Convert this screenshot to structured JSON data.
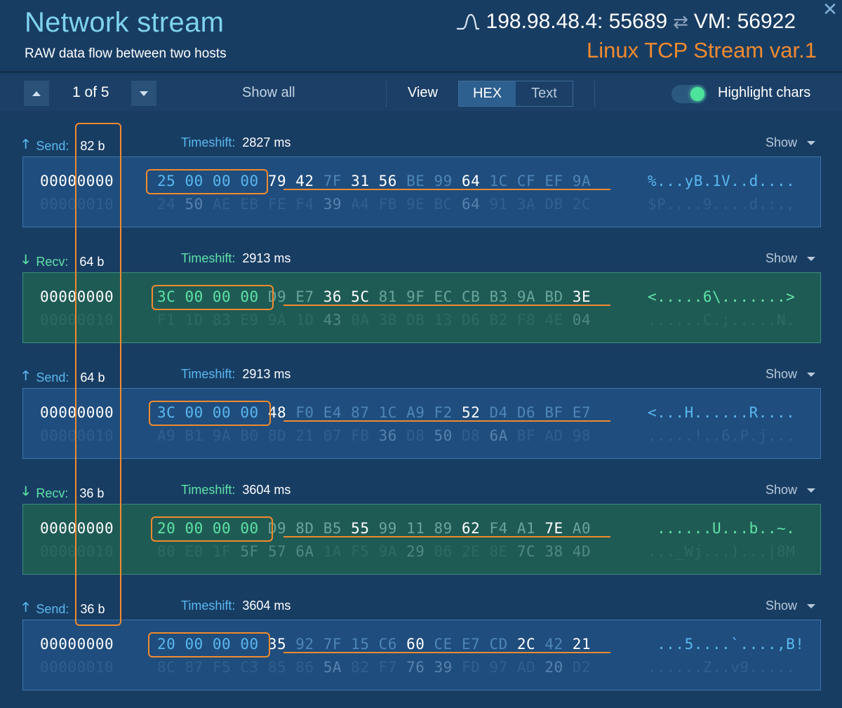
{
  "header": {
    "title": "Network stream",
    "subtitle": "RAW data flow between two hosts",
    "source": "198.98.48.4: 55689",
    "destination": "VM: 56922",
    "stream_name": "Linux TCP Stream var.1"
  },
  "toolbar": {
    "pager": "1 of 5",
    "show_all": "Show all",
    "view_label": "View",
    "view_hex": "HEX",
    "view_text": "Text",
    "highlight_label": "Highlight chars",
    "highlight_on": true
  },
  "labels": {
    "timeshift": "Timeshift:",
    "show": "Show"
  },
  "colors": {
    "accent_orange": "#f08a2e",
    "title_cyan": "#7fd3ee",
    "send_label": "#5ab8f0",
    "recv_label": "#5ee3a6"
  },
  "packets": [
    {
      "direction": "Send:",
      "size": "82 b",
      "timeshift": "2827 ms",
      "offset1": "00000000",
      "offset2": "00000010",
      "hex1": [
        "25",
        "00",
        "00",
        "00",
        "79",
        "42",
        "7F",
        "31",
        "56",
        "BE",
        "99",
        "64",
        "1C",
        "CF",
        "EF",
        "9A"
      ],
      "hex2": [
        "24",
        "50",
        "AE",
        "EB",
        "FE",
        "F4",
        "39",
        "A4",
        "FB",
        "9E",
        "BC",
        "64",
        "91",
        "3A",
        "DB",
        "2C"
      ],
      "ascii1": "%...yB.1V..d....",
      "ascii2": "$P....9....d.:.,"
    },
    {
      "direction": "Recv:",
      "size": "64 b",
      "timeshift": "2913 ms",
      "offset1": "00000000",
      "offset2": "00000010",
      "hex1": [
        "3C",
        "00",
        "00",
        "00",
        "D9",
        "E7",
        "36",
        "5C",
        "81",
        "9F",
        "EC",
        "CB",
        "B3",
        "9A",
        "BD",
        "3E"
      ],
      "hex2": [
        "F1",
        "1D",
        "83",
        "E9",
        "9A",
        "1D",
        "43",
        "0A",
        "3B",
        "DB",
        "13",
        "D6",
        "B2",
        "F8",
        "4E",
        "04"
      ],
      "ascii1": "<.....6\\.......>",
      "ascii2": "......C.;.....N."
    },
    {
      "direction": "Send:",
      "size": "64 b",
      "timeshift": "2913 ms",
      "offset1": "00000000",
      "offset2": "00000010",
      "hex1": [
        "3C",
        "00",
        "00",
        "00",
        "48",
        "F0",
        "E4",
        "87",
        "1C",
        "A9",
        "F2",
        "52",
        "D4",
        "D6",
        "BF",
        "E7"
      ],
      "hex2": [
        "A9",
        "B1",
        "9A",
        "B0",
        "8D",
        "21",
        "07",
        "FB",
        "36",
        "D8",
        "50",
        "D8",
        "6A",
        "BF",
        "AD",
        "98"
      ],
      "ascii1": "<...H......R....",
      "ascii2": ".....!..6.P.j..."
    },
    {
      "direction": "Recv:",
      "size": "36 b",
      "timeshift": "3604 ms",
      "offset1": "00000000",
      "offset2": "00000010",
      "hex1": [
        "20",
        "00",
        "00",
        "00",
        "D9",
        "8D",
        "B5",
        "55",
        "99",
        "11",
        "89",
        "62",
        "F4",
        "A1",
        "7E",
        "A0"
      ],
      "hex2": [
        "80",
        "E0",
        "1F",
        "5F",
        "57",
        "6A",
        "1A",
        "F5",
        "9A",
        "29",
        "06",
        "2E",
        "8E",
        "7C",
        "38",
        "4D"
      ],
      "ascii1": " ......U...b..~.",
      "ascii2": "..._Wj...)...|8M"
    },
    {
      "direction": "Send:",
      "size": "36 b",
      "timeshift": "3604 ms",
      "offset1": "00000000",
      "offset2": "00000010",
      "hex1": [
        "20",
        "00",
        "00",
        "00",
        "35",
        "92",
        "7F",
        "15",
        "C6",
        "60",
        "CE",
        "E7",
        "CD",
        "2C",
        "42",
        "21"
      ],
      "hex2": [
        "8C",
        "87",
        "F5",
        "C3",
        "85",
        "86",
        "5A",
        "82",
        "F7",
        "76",
        "39",
        "FD",
        "97",
        "AD",
        "20",
        "D2"
      ],
      "ascii1": " ...5....`....,B!",
      "ascii2": "......Z..v9....."
    }
  ]
}
